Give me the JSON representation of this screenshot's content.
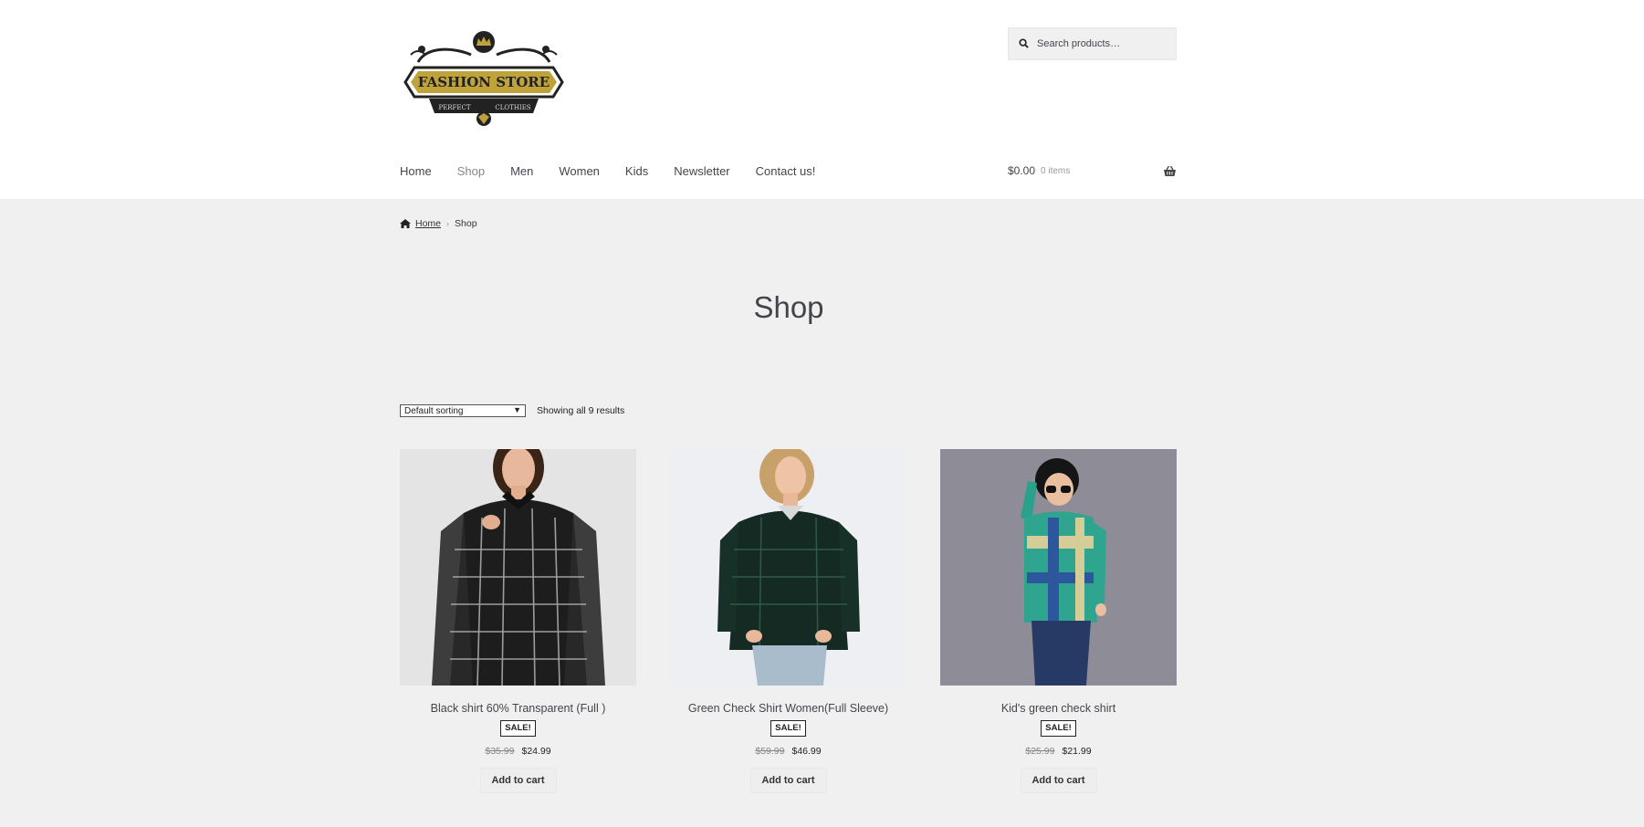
{
  "brand": {
    "logo_title": "FASHION STORE",
    "logo_left": "PERFECT",
    "logo_right": "CLOTHIES",
    "gold": "#bfa23a",
    "dark": "#222222"
  },
  "search": {
    "placeholder": "Search products…"
  },
  "nav": {
    "items": [
      {
        "label": "Home"
      },
      {
        "label": "Shop"
      },
      {
        "label": "Men"
      },
      {
        "label": "Women"
      },
      {
        "label": "Kids"
      },
      {
        "label": "Newsletter"
      },
      {
        "label": "Contact us!"
      }
    ],
    "active": "Shop"
  },
  "cart": {
    "amount": "$0.00",
    "items": "0 items"
  },
  "breadcrumb": {
    "home": "Home",
    "current": "Shop"
  },
  "page": {
    "title": "Shop"
  },
  "toolbar": {
    "sort": "Default sorting",
    "result_count": "Showing all 9 results"
  },
  "products": [
    {
      "name": "Black shirt 60% Transparent (Full )",
      "badge": "SALE!",
      "old_price": "$35.99",
      "price": "$24.99",
      "button": "Add to cart"
    },
    {
      "name": "Green Check Shirt Women(Full Sleeve)",
      "badge": "SALE!",
      "old_price": "$59.99",
      "price": "$46.99",
      "button": "Add to cart"
    },
    {
      "name": "Kid's green check shirt",
      "badge": "SALE!",
      "old_price": "$25.99",
      "price": "$21.99",
      "button": "Add to cart"
    }
  ]
}
